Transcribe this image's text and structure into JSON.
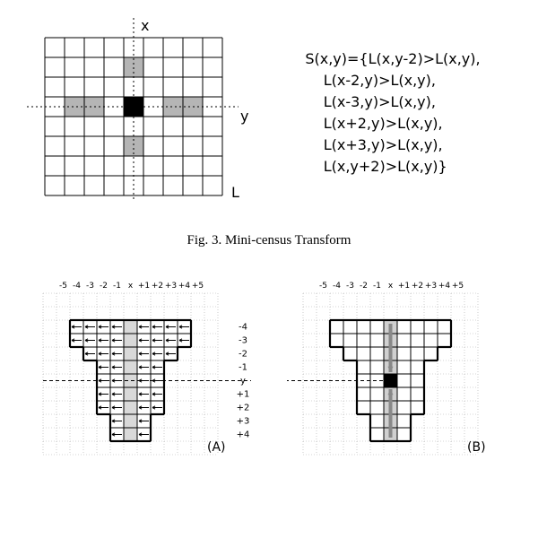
{
  "top": {
    "x_axis_label": "x",
    "y_axis_label": "y",
    "corner_label": "L",
    "grid_cols": 9,
    "grid_rows": 8,
    "center": [
      4,
      3
    ],
    "black_cell": [
      4,
      3
    ],
    "gray_cells": [
      [
        4,
        1
      ],
      [
        1,
        3
      ],
      [
        2,
        3
      ],
      [
        6,
        3
      ],
      [
        7,
        3
      ],
      [
        4,
        5
      ]
    ]
  },
  "formula": {
    "header": "S(x,y)={L(x,y-2)>L(x,y),",
    "lines": [
      "L(x-2,y)>L(x,y),",
      "L(x-3,y)>L(x,y),",
      "L(x+2,y)>L(x,y),",
      "L(x+3,y)>L(x,y),",
      "L(x,y+2)>L(x,y)}"
    ]
  },
  "caption": "Fig. 3.   Mini-census Transform",
  "bottom": {
    "x_ticks": [
      "-5",
      "-4",
      "-3",
      "-2",
      "-1",
      "x",
      "+1",
      "+2",
      "+3",
      "+4",
      "+5"
    ],
    "y_ticks": [
      "-4",
      "-3",
      "-2",
      "-1",
      "y",
      "+1",
      "+2",
      "+3",
      "+4"
    ],
    "labelA": "(A)",
    "labelB": "(B)",
    "grid_cols": 13,
    "grid_rows": 12,
    "shape_rows": [
      {
        "y": 2,
        "x0": 2,
        "x1": 10
      },
      {
        "y": 3,
        "x0": 2,
        "x1": 10
      },
      {
        "y": 4,
        "x0": 3,
        "x1": 9
      },
      {
        "y": 5,
        "x0": 4,
        "x1": 8
      },
      {
        "y": 6,
        "x0": 4,
        "x1": 8
      },
      {
        "y": 7,
        "x0": 4,
        "x1": 8
      },
      {
        "y": 8,
        "x0": 4,
        "x1": 8
      },
      {
        "y": 9,
        "x0": 5,
        "x1": 7
      },
      {
        "y": 10,
        "x0": 5,
        "x1": 7
      }
    ],
    "center": [
      6,
      6
    ],
    "center_col": 6,
    "shape_y0": 2,
    "shape_y1": 10
  }
}
